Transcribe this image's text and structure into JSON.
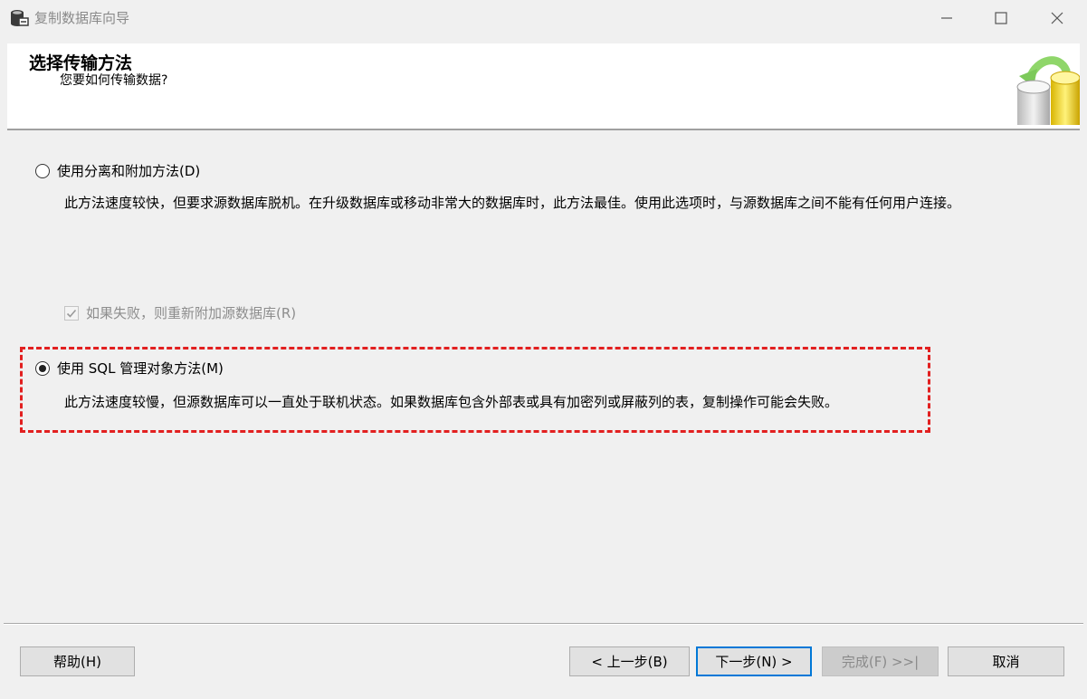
{
  "window": {
    "title": "复制数据库向导",
    "icon": "database-icon"
  },
  "header": {
    "title": "选择传输方法",
    "subtitle": "您要如何传输数据?"
  },
  "options": {
    "detach_attach": {
      "label": "使用分离和附加方法(D)",
      "selected": false,
      "description": "此方法速度较快，但要求源数据库脱机。在升级数据库或移动非常大的数据库时，此方法最佳。使用此选项时，与源数据库之间不能有任何用户连接。"
    },
    "reattach_checkbox": {
      "label": "如果失败，则重新附加源数据库(R)",
      "checked": true,
      "enabled": false
    },
    "smo": {
      "label": "使用 SQL 管理对象方法(M)",
      "selected": true,
      "description": "此方法速度较慢，但源数据库可以一直处于联机状态。如果数据库包含外部表或具有加密列或屏蔽列的表，复制操作可能会失败。"
    }
  },
  "buttons": {
    "help": "帮助(H)",
    "back": "< 上一步(B)",
    "next": "下一步(N) >",
    "finish": "完成(F) >>|",
    "cancel": "取消"
  },
  "colors": {
    "highlight": "#e22020",
    "default_button_border": "#0078d7"
  }
}
